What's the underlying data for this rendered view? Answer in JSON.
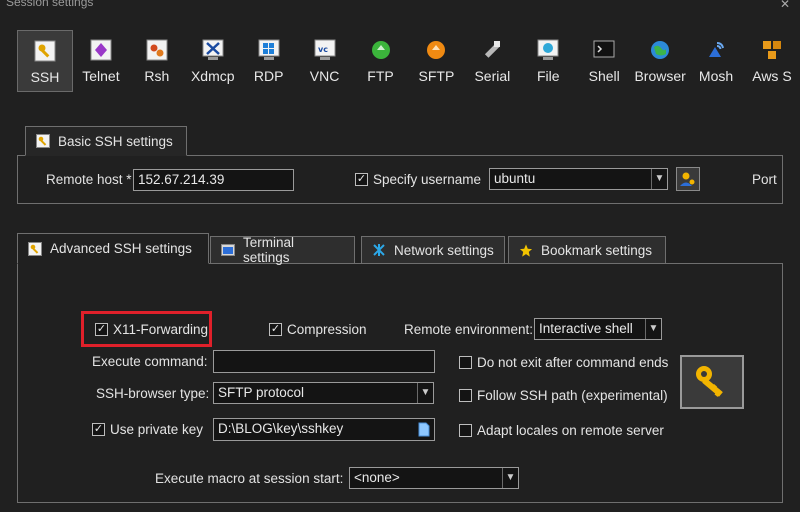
{
  "window": {
    "title": "Session settings"
  },
  "toolbar": [
    {
      "label": "SSH",
      "icon": "ssh-key-icon",
      "active": true
    },
    {
      "label": "Telnet",
      "icon": "telnet-icon"
    },
    {
      "label": "Rsh",
      "icon": "rsh-icon"
    },
    {
      "label": "Xdmcp",
      "icon": "xdmcp-icon"
    },
    {
      "label": "RDP",
      "icon": "rdp-icon"
    },
    {
      "label": "VNC",
      "icon": "vnc-icon"
    },
    {
      "label": "FTP",
      "icon": "ftp-icon"
    },
    {
      "label": "SFTP",
      "icon": "sftp-icon"
    },
    {
      "label": "Serial",
      "icon": "serial-icon"
    },
    {
      "label": "File",
      "icon": "file-icon"
    },
    {
      "label": "Shell",
      "icon": "shell-icon"
    },
    {
      "label": "Browser",
      "icon": "browser-icon"
    },
    {
      "label": "Mosh",
      "icon": "mosh-icon"
    },
    {
      "label": "Aws S",
      "icon": "aws-icon"
    }
  ],
  "basic": {
    "tab_label": "Basic SSH settings",
    "remote_host_label": "Remote host *",
    "remote_host_value": "152.67.214.39",
    "specify_username_label": "Specify username",
    "username_value": "ubuntu",
    "port_label": "Port"
  },
  "advanced_tabs": [
    {
      "label": "Advanced SSH settings",
      "active": true
    },
    {
      "label": "Terminal settings"
    },
    {
      "label": "Network settings"
    },
    {
      "label": "Bookmark settings"
    }
  ],
  "advanced": {
    "x11_label": "X11-Forwarding",
    "compression_label": "Compression",
    "remote_env_label": "Remote environment:",
    "remote_env_value": "Interactive shell",
    "exec_command_label": "Execute command:",
    "exec_command_value": "",
    "no_exit_label": "Do not exit after command ends",
    "browser_type_label": "SSH-browser type:",
    "browser_type_value": "SFTP protocol",
    "follow_path_label": "Follow SSH path (experimental)",
    "private_key_label": "Use private key",
    "private_key_value": "D:\\BLOG\\key\\sshkey",
    "adapt_locales_label": "Adapt locales on remote server",
    "macro_label": "Execute macro at session start:",
    "macro_value": "<none>"
  },
  "colors": {
    "highlight": "#e0202a",
    "key": "#f2b400"
  }
}
